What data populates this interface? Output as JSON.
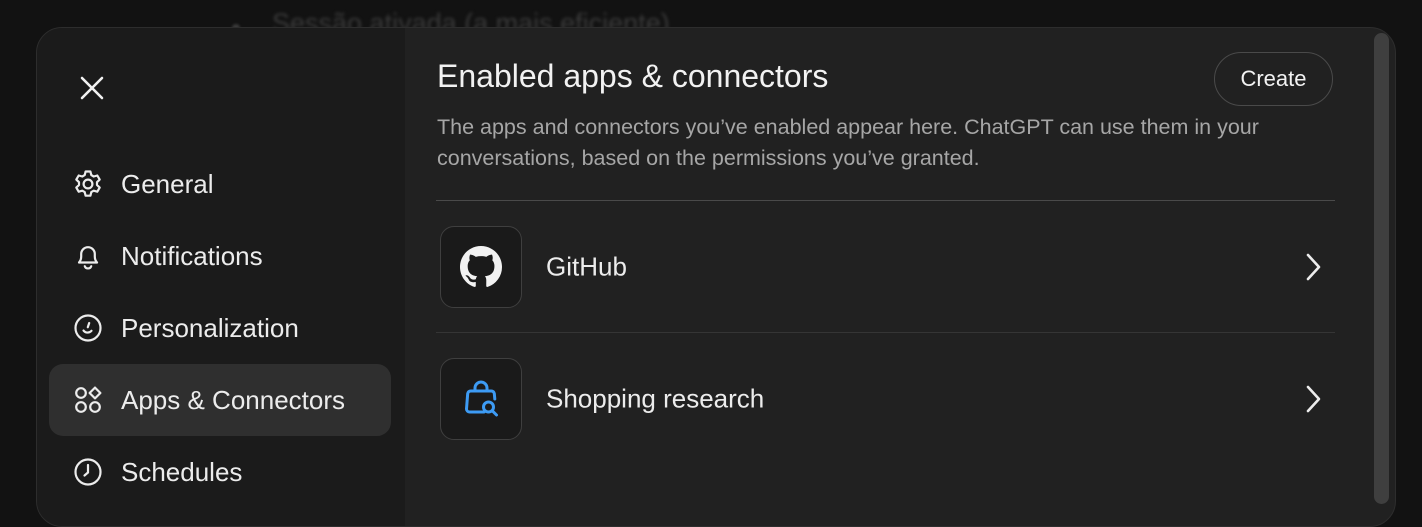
{
  "backdrop": {
    "text": "Sessão ativada (a mais eficiente)"
  },
  "sidebar": {
    "items": [
      {
        "label": "General",
        "icon": "gear-icon"
      },
      {
        "label": "Notifications",
        "icon": "bell-icon"
      },
      {
        "label": "Personalization",
        "icon": "personalization-icon"
      },
      {
        "label": "Apps & Connectors",
        "icon": "apps-icon",
        "active": true
      },
      {
        "label": "Schedules",
        "icon": "clock-icon"
      }
    ]
  },
  "main": {
    "title": "Enabled apps & connectors",
    "description": "The apps and connectors you’ve enabled appear here. ChatGPT can use them in your conversations, based on the permissions you’ve granted.",
    "create_label": "Create",
    "apps": [
      {
        "name": "GitHub",
        "icon": "github-icon"
      },
      {
        "name": "Shopping research",
        "icon": "shopping-bag-search-icon",
        "icon_color": "#3d9bf4"
      }
    ]
  },
  "colors": {
    "modal_bg": "#212121",
    "sidebar_bg": "#1b1b1b",
    "active_item_bg": "#2f2f2f",
    "accent_blue": "#3d9bf4"
  }
}
